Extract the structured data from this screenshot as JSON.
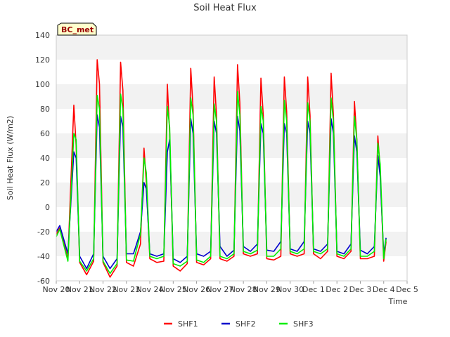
{
  "chart_data": {
    "type": "line",
    "title": "Soil Heat Flux",
    "xlabel": "Time",
    "ylabel": "Soil Heat Flux (W/m2)",
    "ylim": [
      -60,
      140
    ],
    "yticks": [
      -60,
      -40,
      -20,
      0,
      20,
      40,
      60,
      80,
      100,
      120,
      140
    ],
    "xlim": [
      0,
      15
    ],
    "xtick_labels": [
      "Nov 20",
      "Nov 21",
      "Nov 22",
      "Nov 23",
      "Nov 24",
      "Nov 25",
      "Nov 26",
      "Nov 27",
      "Nov 28",
      "Nov 29",
      "Nov 30",
      "Dec 1",
      "Dec 2",
      "Dec 3",
      "Dec 4",
      "Dec 5"
    ],
    "grid": "horizontal bands",
    "badge": "BC_met",
    "legend": {
      "position": "bottom-center",
      "entries": [
        "SHF1",
        "SHF2",
        "SHF3"
      ]
    },
    "series": [
      {
        "name": "SHF1",
        "color": "#ff0000",
        "x": [
          0.0,
          0.15,
          0.5,
          0.75,
          0.85,
          1.0,
          1.3,
          1.6,
          1.75,
          1.85,
          2.0,
          2.3,
          2.6,
          2.75,
          2.85,
          3.0,
          3.3,
          3.6,
          3.75,
          3.85,
          4.0,
          4.3,
          4.6,
          4.75,
          4.85,
          5.0,
          5.3,
          5.6,
          5.75,
          5.85,
          6.0,
          6.3,
          6.6,
          6.75,
          6.85,
          7.0,
          7.3,
          7.6,
          7.75,
          7.85,
          8.0,
          8.3,
          8.6,
          8.75,
          8.85,
          9.0,
          9.3,
          9.6,
          9.75,
          9.85,
          10.0,
          10.3,
          10.6,
          10.75,
          10.85,
          11.0,
          11.3,
          11.6,
          11.75,
          11.85,
          12.0,
          12.3,
          12.6,
          12.75,
          12.85,
          13.0,
          13.3,
          13.6,
          13.75,
          13.85,
          14.0,
          14.1
        ],
        "values": [
          -22,
          -17,
          -42,
          83,
          50,
          -45,
          -55,
          -44,
          120,
          100,
          -45,
          -57,
          -48,
          118,
          95,
          -45,
          -48,
          -30,
          48,
          20,
          -42,
          -45,
          -44,
          100,
          60,
          -48,
          -52,
          -46,
          113,
          80,
          -45,
          -47,
          -42,
          106,
          75,
          -42,
          -44,
          -40,
          116,
          85,
          -38,
          -40,
          -38,
          105,
          75,
          -42,
          -43,
          -40,
          106,
          78,
          -38,
          -40,
          -38,
          106,
          75,
          -38,
          -42,
          -36,
          109,
          75,
          -40,
          -42,
          -36,
          86,
          55,
          -42,
          -42,
          -40,
          58,
          30,
          -44,
          -28
        ]
      },
      {
        "name": "SHF2",
        "color": "#0000cc",
        "x": [
          0.0,
          0.15,
          0.5,
          0.75,
          0.85,
          1.0,
          1.3,
          1.6,
          1.75,
          1.85,
          2.0,
          2.3,
          2.6,
          2.75,
          2.85,
          3.0,
          3.3,
          3.6,
          3.75,
          3.85,
          4.0,
          4.3,
          4.6,
          4.75,
          4.85,
          5.0,
          5.3,
          5.6,
          5.75,
          5.85,
          6.0,
          6.3,
          6.6,
          6.75,
          6.85,
          7.0,
          7.3,
          7.6,
          7.75,
          7.85,
          8.0,
          8.3,
          8.6,
          8.75,
          8.85,
          9.0,
          9.3,
          9.6,
          9.75,
          9.85,
          10.0,
          10.3,
          10.6,
          10.75,
          10.85,
          11.0,
          11.3,
          11.6,
          11.75,
          11.85,
          12.0,
          12.3,
          12.6,
          12.75,
          12.85,
          13.0,
          13.3,
          13.6,
          13.75,
          13.85,
          14.0,
          14.1
        ],
        "values": [
          -20,
          -15,
          -38,
          45,
          40,
          -40,
          -50,
          -38,
          75,
          65,
          -40,
          -50,
          -42,
          74,
          65,
          -38,
          -38,
          -20,
          20,
          15,
          -38,
          -40,
          -38,
          45,
          55,
          -42,
          -45,
          -40,
          72,
          60,
          -38,
          -40,
          -36,
          70,
          60,
          -32,
          -40,
          -35,
          74,
          62,
          -32,
          -36,
          -30,
          68,
          60,
          -35,
          -36,
          -28,
          68,
          60,
          -34,
          -36,
          -28,
          70,
          60,
          -34,
          -36,
          -30,
          72,
          60,
          -36,
          -38,
          -30,
          58,
          45,
          -35,
          -38,
          -32,
          42,
          25,
          -38,
          -25
        ]
      },
      {
        "name": "SHF3",
        "color": "#00ee00",
        "x": [
          0.0,
          0.15,
          0.5,
          0.75,
          0.85,
          1.0,
          1.3,
          1.6,
          1.75,
          1.85,
          2.0,
          2.3,
          2.6,
          2.75,
          2.85,
          3.0,
          3.3,
          3.6,
          3.75,
          3.85,
          4.0,
          4.3,
          4.6,
          4.75,
          4.85,
          5.0,
          5.3,
          5.6,
          5.75,
          5.85,
          6.0,
          6.3,
          6.6,
          6.75,
          6.85,
          7.0,
          7.3,
          7.6,
          7.75,
          7.85,
          8.0,
          8.3,
          8.6,
          8.75,
          8.85,
          9.0,
          9.3,
          9.6,
          9.75,
          9.85,
          10.0,
          10.3,
          10.6,
          10.75,
          10.85,
          11.0,
          11.3,
          11.6,
          11.75,
          11.85,
          12.0,
          12.3,
          12.6,
          12.75,
          12.85,
          13.0,
          13.3,
          13.6,
          13.75,
          13.85,
          14.0,
          14.1
        ],
        "values": [
          -24,
          -18,
          -44,
          60,
          55,
          -44,
          -52,
          -42,
          91,
          80,
          -44,
          -54,
          -46,
          92,
          80,
          -43,
          -44,
          -22,
          40,
          28,
          -40,
          -42,
          -40,
          82,
          65,
          -46,
          -48,
          -44,
          89,
          75,
          -43,
          -45,
          -40,
          84,
          70,
          -40,
          -42,
          -38,
          94,
          75,
          -36,
          -38,
          -35,
          82,
          70,
          -40,
          -40,
          -34,
          87,
          70,
          -36,
          -38,
          -34,
          85,
          70,
          -36,
          -38,
          -34,
          89,
          70,
          -38,
          -40,
          -34,
          74,
          55,
          -40,
          -40,
          -36,
          52,
          35,
          -42,
          -26
        ]
      }
    ]
  }
}
